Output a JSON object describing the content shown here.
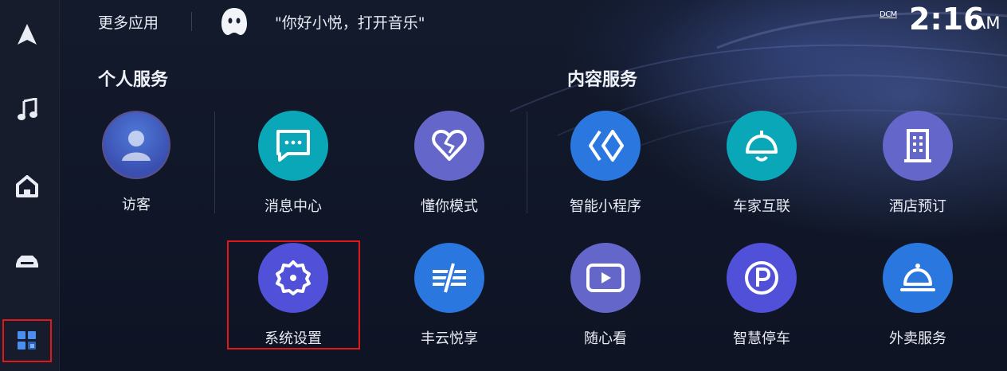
{
  "header": {
    "more_apps": "更多应用",
    "assistant_prompt": "\"你好小悦，打开音乐\"",
    "dcm_label": "DCM",
    "time": "2:16",
    "ampm": "AM"
  },
  "sidebar": {
    "items": [
      {
        "icon": "navigation-icon"
      },
      {
        "icon": "music-note-icon"
      },
      {
        "icon": "home-icon"
      },
      {
        "icon": "car-icon"
      },
      {
        "icon": "apps-grid-icon",
        "active": true
      }
    ]
  },
  "sections": {
    "personal": "个人服务",
    "content": "内容服务"
  },
  "apps": {
    "visitor": {
      "label": "访客",
      "icon": "user-avatar-icon"
    },
    "messages": {
      "label": "消息中心",
      "icon": "message-icon",
      "color": "#0aa7b8"
    },
    "dongni": {
      "label": "懂你模式",
      "icon": "heart-icon",
      "color": "#6467c9"
    },
    "mini_programs": {
      "label": "智能小程序",
      "icon": "mini-program-icon",
      "color": "#2a77e0"
    },
    "car_home": {
      "label": "车家互联",
      "icon": "lamp-icon",
      "color": "#0aa7b8"
    },
    "hotel": {
      "label": "酒店预订",
      "icon": "building-icon",
      "color": "#6467c9"
    },
    "settings": {
      "label": "系统设置",
      "icon": "gear-icon",
      "color": "#5050d8"
    },
    "fengyun": {
      "label": "丰云悦享",
      "icon": "fengyun-icon",
      "color": "#2a77e0"
    },
    "video": {
      "label": "随心看",
      "icon": "play-icon",
      "color": "#6467c9"
    },
    "parking": {
      "label": "智慧停车",
      "icon": "parking-icon",
      "color": "#5050d8"
    },
    "takeout": {
      "label": "外卖服务",
      "icon": "cloche-icon",
      "color": "#2a77e0"
    }
  }
}
